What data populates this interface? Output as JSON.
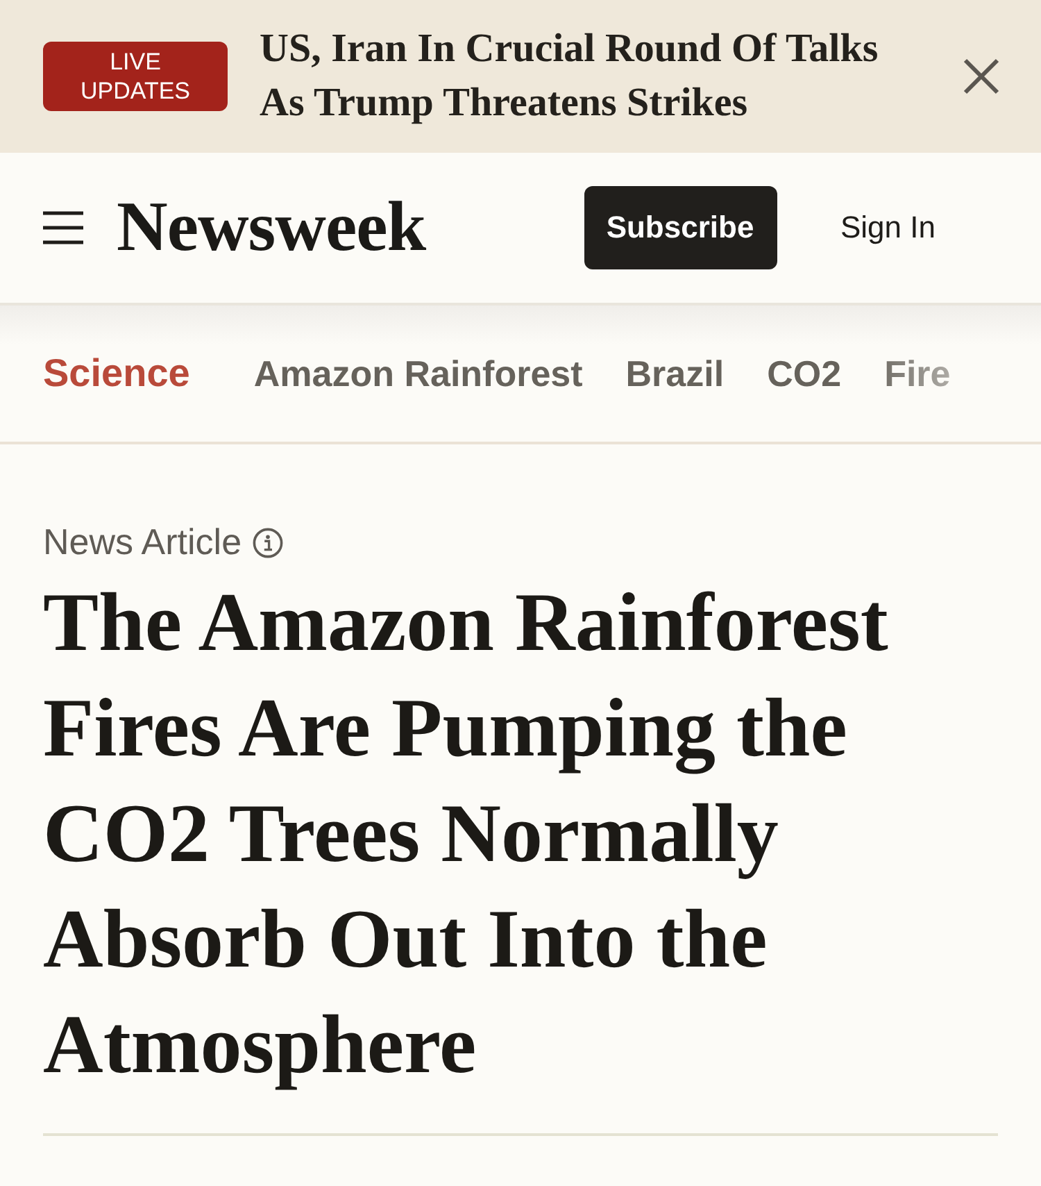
{
  "live_banner": {
    "badge": "LIVE UPDATES",
    "headline": "US, Iran In Crucial Round Of Talks As Trump Threatens Strikes"
  },
  "header": {
    "logo": "Newsweek",
    "subscribe_button": "Subscribe",
    "sign_in": "Sign In"
  },
  "topic_nav": {
    "section": "Science",
    "tags": [
      "Amazon Rainforest",
      "Brazil",
      "CO2",
      "Fire"
    ]
  },
  "article": {
    "label": "News Article",
    "headline": "The Amazon Rainforest Fires Are Pumping the CO2 Trees Normally Absorb Out Into the Atmosphere"
  }
}
